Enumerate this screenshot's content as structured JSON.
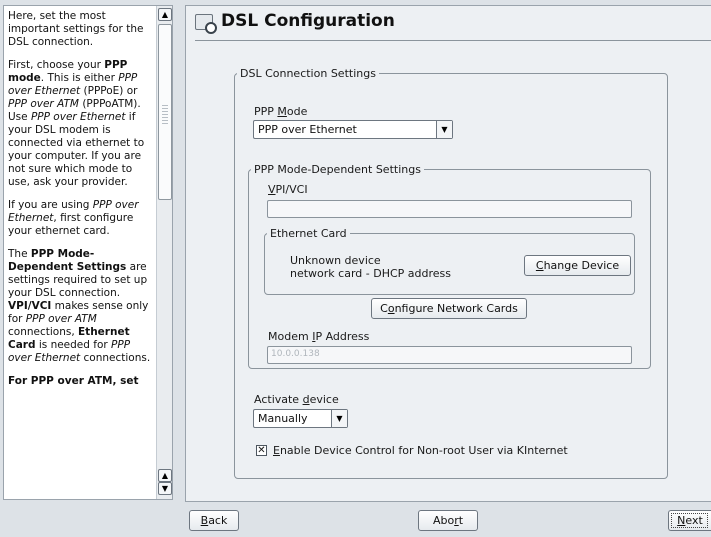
{
  "help": {
    "p1": "Here, set the most important settings for the DSL connection.",
    "p2": {
      "t1": "First, choose your ",
      "b1": "PPP mode",
      "t2": ". This is either ",
      "i1": "PPP over Ethernet",
      "t3": " (PPPoE) or ",
      "i2": "PPP over ATM",
      "t4": " (PPPoATM). Use ",
      "i3": "PPP over Ethernet",
      "t5": " if your DSL modem is connected via ethernet to your computer. If you are not sure which mode to use, ask your provider."
    },
    "p3": {
      "t1": "If you are using ",
      "i1": "PPP over Ethernet",
      "t2": ", first configure your ethernet card."
    },
    "p4": {
      "t1": "The ",
      "b1": "PPP Mode-Dependent Settings",
      "t2": " are settings required to set up your DSL connection. ",
      "b2": "VPI/VCI",
      "t3": " makes sense only for ",
      "i1": "PPP over ATM",
      "t4": " connections, ",
      "b3": "Ethernet Card",
      "t5": " is needed for ",
      "i2": "PPP over Ethernet",
      "t6": " connections."
    },
    "p5": {
      "b1": "For PPP over ATM, set"
    }
  },
  "icons": {
    "scroll_up": "▲",
    "scroll_down": "▼",
    "dropdown": "▼",
    "checkmark": "✕",
    "title_icon": "dsl-config-icon"
  },
  "header": {
    "title": "DSL Configuration"
  },
  "connection": {
    "legend": "DSL Connection Settings",
    "ppp_mode": {
      "label_pre": "PPP ",
      "label_accel": "M",
      "label_post": "ode",
      "value": "PPP over Ethernet"
    },
    "dependent": {
      "legend": "PPP Mode-Dependent Settings",
      "vpi": {
        "label_accel": "V",
        "label_post": "PI/VCI",
        "value": ""
      },
      "ethernet": {
        "legend": "Ethernet Card",
        "line1": "Unknown device",
        "line2": "network card - DHCP address",
        "change_accel": "C",
        "change_post": "hange Device"
      },
      "configure_pre": "C",
      "configure_accel": "o",
      "configure_post": "nfigure Network Cards",
      "modem_ip": {
        "label_pre": "Modem ",
        "label_accel": "I",
        "label_post": "P Address",
        "value": "10.0.0.138"
      }
    },
    "activate": {
      "label_pre": "Activate ",
      "label_accel": "d",
      "label_post": "evice",
      "value": "Manually"
    },
    "enable_control": {
      "label_accel": "E",
      "label_post": "nable Device Control for Non-root User via KInternet",
      "checked": true
    }
  },
  "nav": {
    "back_accel": "B",
    "back_post": "ack",
    "abort_pre": "Abo",
    "abort_accel": "r",
    "abort_post": "t",
    "next_accel": "N",
    "next_post": "ext"
  }
}
